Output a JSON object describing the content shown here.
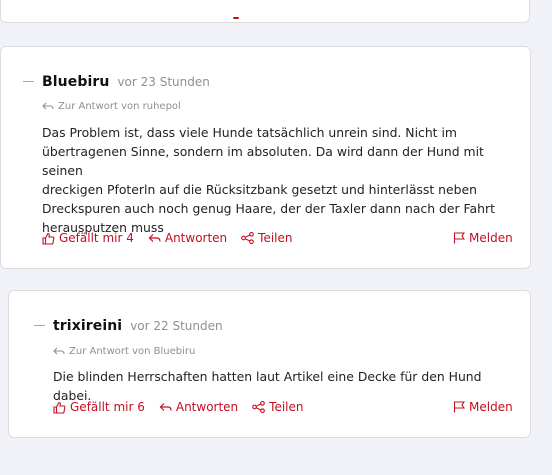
{
  "comments": [
    {
      "author": "Bluebiru",
      "time": "vor 23 Stunden",
      "reply_to": "Zur Antwort von ruhepol",
      "text_lines": [
        "Das Problem ist, dass viele Hunde tatsächlich unrein sind. Nicht im",
        "übertragenen Sinne, sondern im absoluten. Da wird dann der Hund mit seinen",
        "dreckigen Pfoterln auf die Rücksitzbank gesetzt und hinterlässt neben",
        "Dreckspuren auch noch genug Haare, der der Taxler dann nach der Fahrt",
        "herausputzen muss"
      ],
      "like_label": "Gefällt mir 4",
      "reply_label": "Antworten",
      "share_label": "Teilen",
      "report_label": "Melden"
    },
    {
      "author": "trixireini",
      "time": "vor 22 Stunden",
      "reply_to": "Zur Antwort von Bluebiru",
      "text_lines": [
        "Die blinden Herrschaften hatten laut Artikel eine Decke für den Hund dabei."
      ],
      "like_label": "Gefällt mir 6",
      "reply_label": "Antworten",
      "share_label": "Teilen",
      "report_label": "Melden"
    }
  ],
  "colors": {
    "accent": "#c50e1f",
    "muted": "#8d8f96",
    "background": "#f1f2f7"
  },
  "icons": [
    "thumbs-up-icon",
    "reply-arrow-icon",
    "share-icon",
    "flag-icon"
  ]
}
